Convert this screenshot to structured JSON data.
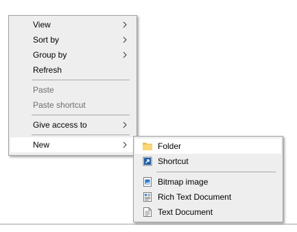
{
  "context_menu": {
    "items": [
      {
        "label": "View"
      },
      {
        "label": "Sort by"
      },
      {
        "label": "Group by"
      },
      {
        "label": "Refresh"
      },
      {
        "label": "Paste"
      },
      {
        "label": "Paste shortcut"
      },
      {
        "label": "Give access to"
      },
      {
        "label": "New"
      }
    ]
  },
  "new_submenu": {
    "items": [
      {
        "label": "Folder",
        "icon": "folder-icon"
      },
      {
        "label": "Shortcut",
        "icon": "shortcut-icon"
      },
      {
        "label": "Bitmap image",
        "icon": "bitmap-image-icon"
      },
      {
        "label": "Rich Text Document",
        "icon": "rich-text-document-icon"
      },
      {
        "label": "Text Document",
        "icon": "text-document-icon"
      }
    ]
  },
  "colors": {
    "menu_background": "#eeeeee",
    "highlight_background": "#ffffff",
    "disabled_text": "#6d6d6d",
    "folder_yellow": "#f8d775",
    "shortcut_blue": "#1e5fa8"
  }
}
